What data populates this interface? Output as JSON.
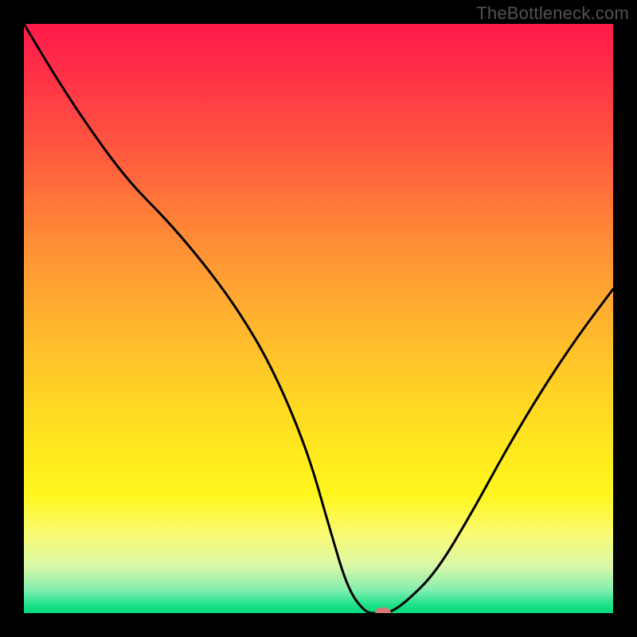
{
  "watermark": "TheBottleneck.com",
  "chart_data": {
    "type": "line",
    "title": "",
    "xlabel": "",
    "ylabel": "",
    "xlim": [
      0,
      100
    ],
    "ylim": [
      0,
      100
    ],
    "grid": false,
    "legend": false,
    "background": {
      "type": "vertical-gradient",
      "stops": [
        {
          "pos": 0,
          "color": "#ff1a4b"
        },
        {
          "pos": 0.08,
          "color": "#ff2f48"
        },
        {
          "pos": 0.22,
          "color": "#ff5a3e"
        },
        {
          "pos": 0.36,
          "color": "#ff8a36"
        },
        {
          "pos": 0.5,
          "color": "#ffb22f"
        },
        {
          "pos": 0.62,
          "color": "#ffd125"
        },
        {
          "pos": 0.72,
          "color": "#ffe81f"
        },
        {
          "pos": 0.8,
          "color": "#fff61e"
        },
        {
          "pos": 0.87,
          "color": "#f8fb78"
        },
        {
          "pos": 0.92,
          "color": "#d9f8a8"
        },
        {
          "pos": 0.96,
          "color": "#85eeb0"
        },
        {
          "pos": 0.985,
          "color": "#22e28a"
        },
        {
          "pos": 1.0,
          "color": "#00d97e"
        }
      ]
    },
    "series": [
      {
        "name": "bottleneck-curve",
        "color": "#000000",
        "x": [
          0,
          6,
          12,
          18,
          24,
          30,
          36,
          42,
          48,
          52,
          55,
          58,
          60,
          62,
          65,
          70,
          76,
          82,
          88,
          94,
          100
        ],
        "y": [
          100,
          90,
          81,
          73,
          67,
          60,
          52,
          42,
          28,
          14,
          4,
          0,
          0,
          0,
          2,
          7,
          17,
          28,
          38,
          47,
          55
        ]
      }
    ],
    "marker": {
      "x": 61,
      "y": 0,
      "color": "#cf7b73"
    }
  }
}
